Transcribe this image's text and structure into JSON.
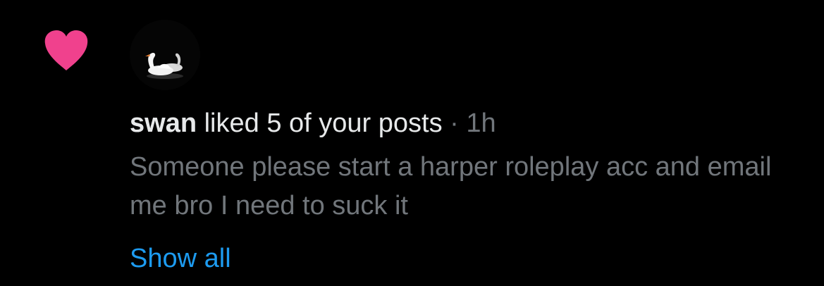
{
  "notification": {
    "username": "swan",
    "action_text": "liked 5 of your posts",
    "separator": "·",
    "time": "1h",
    "post_text": "Someone please start a harper roleplay acc and email me bro I need to suck it",
    "show_all_label": "Show all"
  },
  "icons": {
    "like": "heart-icon",
    "avatar": "swan-avatar"
  },
  "colors": {
    "background": "#000000",
    "heart": "#f91880",
    "primary_text": "#e7e9ea",
    "secondary_text": "#71767b",
    "link": "#1d9bf0"
  }
}
